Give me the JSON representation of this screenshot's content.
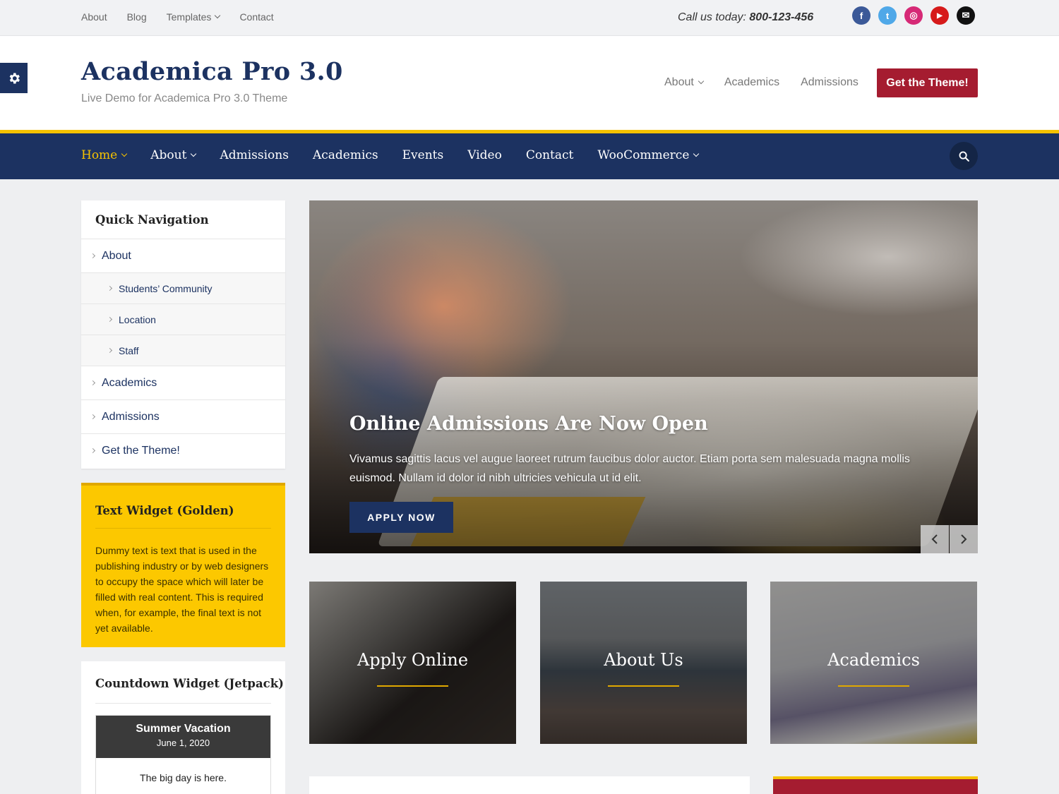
{
  "topbar": {
    "menu": [
      {
        "label": "About"
      },
      {
        "label": "Blog"
      },
      {
        "label": "Templates"
      },
      {
        "label": "Contact"
      }
    ],
    "call_prefix": "Call us today:",
    "phone": "800-123-456",
    "social": [
      {
        "name": "facebook-icon",
        "glyph": "f",
        "color": "#3b5998"
      },
      {
        "name": "twitter-icon",
        "glyph": "t",
        "color": "#4fa8e8"
      },
      {
        "name": "instagram-icon",
        "glyph": "◎",
        "color": "#d62976"
      },
      {
        "name": "youtube-icon",
        "glyph": "▶",
        "color": "#d61a1a"
      },
      {
        "name": "email-icon",
        "glyph": "✉",
        "color": "#111111"
      }
    ]
  },
  "header": {
    "site_title": "Academica Pro 3.0",
    "site_description": "Live Demo for Academica Pro 3.0 Theme",
    "menu": [
      {
        "label": "About"
      },
      {
        "label": "Academics"
      },
      {
        "label": "Admissions"
      }
    ],
    "cta_label": "Get the Theme!"
  },
  "main_nav": {
    "items": [
      {
        "label": "Home",
        "active": true
      },
      {
        "label": "About"
      },
      {
        "label": "Admissions"
      },
      {
        "label": "Academics"
      },
      {
        "label": "Events"
      },
      {
        "label": "Video"
      },
      {
        "label": "Contact"
      },
      {
        "label": "WooCommerce"
      }
    ]
  },
  "sidebar": {
    "quick_nav": {
      "title": "Quick Navigation",
      "items": [
        {
          "label": "About",
          "level": 1
        },
        {
          "label": "Students’ Community",
          "level": 2
        },
        {
          "label": "Location",
          "level": 2
        },
        {
          "label": "Staff",
          "level": 2
        },
        {
          "label": "Academics",
          "level": 1
        },
        {
          "label": "Admissions",
          "level": 1
        },
        {
          "label": "Get the Theme!",
          "level": 1
        }
      ]
    },
    "golden": {
      "title": "Text Widget (Golden)",
      "text": "Dummy text is text that is used in the publishing industry or by web designers to occupy the space which will later be filled with real content. This is required when, for example, the final text is not yet available."
    },
    "countdown": {
      "title": "Countdown Widget (Jetpack)",
      "event": "Summer Vacation",
      "date": "June 1, 2020",
      "message": "The big day is here."
    }
  },
  "slider": {
    "title": "Online Admissions Are Now Open",
    "text": "Vivamus sagittis lacus vel augue laoreet rutrum faucibus dolor auctor. Etiam porta sem malesuada magna mollis euismod. Nullam id dolor id nibh ultricies vehicula ut id elit.",
    "button_label": "APPLY NOW"
  },
  "featured": [
    {
      "label": "Apply Online"
    },
    {
      "label": "About Us"
    },
    {
      "label": "Academics"
    }
  ],
  "colors": {
    "navy": "#1c3261",
    "gold": "#f5c200",
    "crimson": "#a51c30"
  }
}
